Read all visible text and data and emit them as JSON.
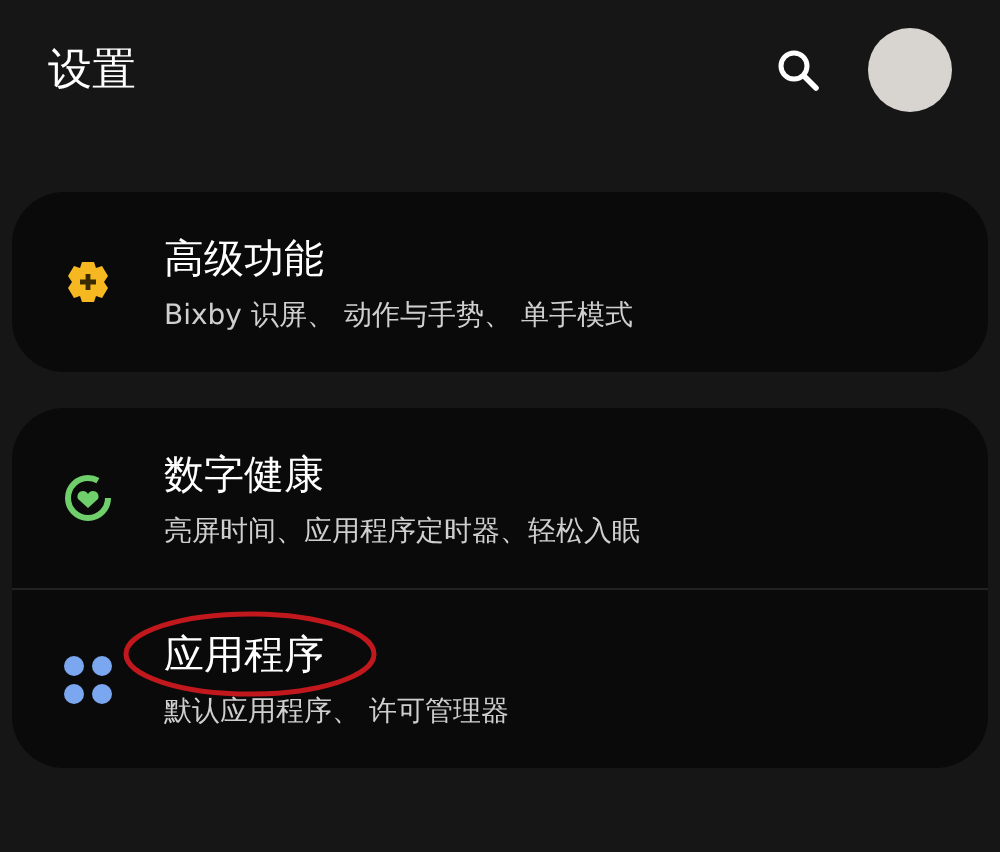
{
  "header": {
    "title": "设置"
  },
  "groups": [
    {
      "items": [
        {
          "kind": "advanced",
          "title": "高级功能",
          "subtitle": "Bixby 识屏、 动作与手势、 单手模式",
          "circled": false
        }
      ]
    },
    {
      "items": [
        {
          "kind": "wellbeing",
          "title": "数字健康",
          "subtitle": "亮屏时间、应用程序定时器、轻松入眠",
          "circled": false
        },
        {
          "kind": "apps",
          "title": "应用程序",
          "subtitle": "默认应用程序、 许可管理器",
          "circled": true
        }
      ]
    }
  ]
}
